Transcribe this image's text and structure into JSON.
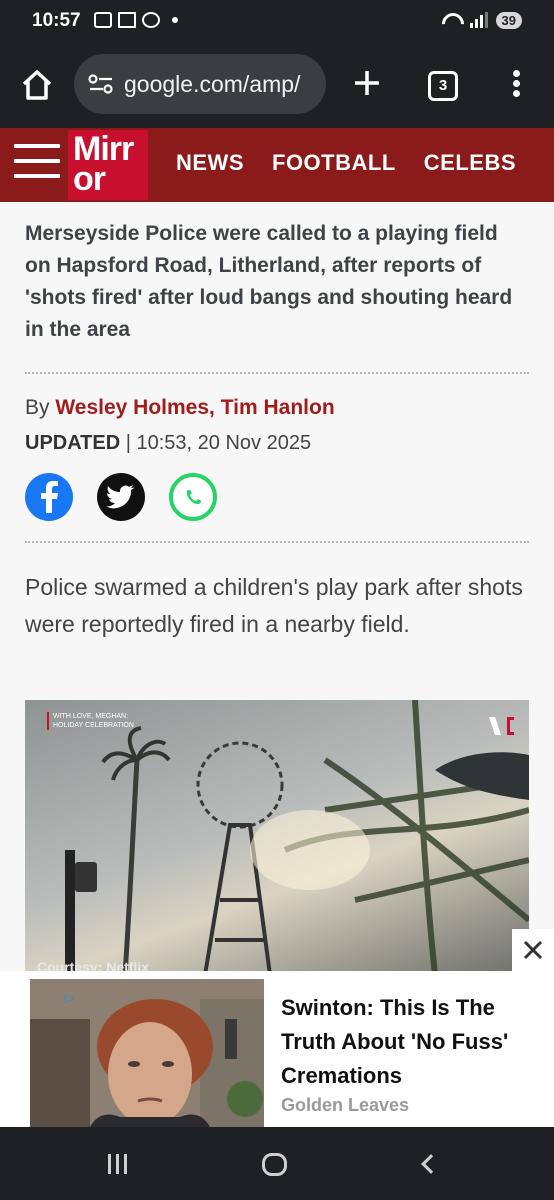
{
  "status_bar": {
    "time": "10:57",
    "battery": "39"
  },
  "browser": {
    "url": "google.com/amp/",
    "tab_count": "3"
  },
  "site": {
    "logo_line1": "Mirr",
    "logo_line2": "or",
    "nav": [
      "NEWS",
      "FOOTBALL",
      "CELEBS"
    ]
  },
  "article": {
    "standfirst": "Merseyside Police were called to a playing field on Hapsford Road, Litherland, after reports of 'shots fired' after loud bangs and shouting heard in the area",
    "by_prefix": "By",
    "authors": "Wesley Holmes, Tim Hanlon",
    "updated_label": "UPDATED",
    "updated_time": "10:53, 20 Nov 2025",
    "lede": "Police swarmed a children's play park after shots were reportedly fired in a nearby field."
  },
  "video": {
    "brand_line1": "WITH LOVE, MEGHAN:",
    "brand_line2": "HOLIDAY CELEBRATION",
    "credit": "Courtesy: Netflix"
  },
  "ad": {
    "headline": "Swinton: This Is The Truth About 'No Fuss' Cremations",
    "source": "Golden Leaves"
  },
  "colors": {
    "header_red": "#8b1a1a",
    "logo_red": "#c8102e",
    "author_red": "#a31c1c"
  }
}
